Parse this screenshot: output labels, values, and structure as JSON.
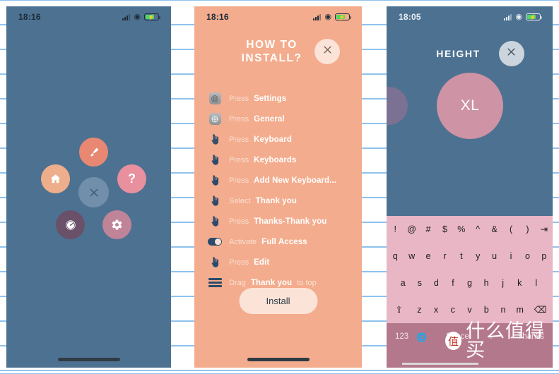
{
  "background": {
    "kind": "ruled-paper",
    "line_color": "#8fc2ee",
    "line_spacing_px": 35
  },
  "panel1": {
    "status": {
      "time": "18:16",
      "signal": "signal-bars-icon",
      "wifi": "wifi-icon",
      "battery": "battery-charging-icon"
    },
    "fab_menu": {
      "center": {
        "label": "",
        "icon": "close-x-icon",
        "color": "#718faa"
      },
      "items": [
        {
          "name": "brush",
          "icon": "paint-brush-icon",
          "color": "#e88872"
        },
        {
          "name": "home",
          "icon": "home-icon",
          "color": "#eeae8b"
        },
        {
          "name": "help",
          "icon": "question-mark-icon",
          "color": "#e9909f",
          "glyph": "?"
        },
        {
          "name": "speed",
          "icon": "speedometer-icon",
          "color": "#6a5069"
        },
        {
          "name": "settings",
          "icon": "gear-icon",
          "color": "#c08498"
        }
      ]
    }
  },
  "panel2": {
    "status": {
      "time": "18:16",
      "signal": "signal-bars-icon",
      "wifi": "wifi-icon",
      "battery": "battery-charging-icon"
    },
    "title_line1": "HOW TO",
    "title_line2": "INSTALL?",
    "close_label": "×",
    "background_color": "#f3ac8d",
    "steps": [
      {
        "icon": "ios-settings-icon",
        "verb": "Press",
        "target": "Settings",
        "suffix": ""
      },
      {
        "icon": "ios-general-icon",
        "verb": "Press",
        "target": "General",
        "suffix": ""
      },
      {
        "icon": "tap-hand-icon",
        "verb": "Press",
        "target": "Keyboard",
        "suffix": ""
      },
      {
        "icon": "tap-hand-icon",
        "verb": "Press",
        "target": "Keyboards",
        "suffix": ""
      },
      {
        "icon": "tap-hand-icon",
        "verb": "Press",
        "target": "Add New Keyboard...",
        "suffix": ""
      },
      {
        "icon": "tap-hand-icon",
        "verb": "Select",
        "target": "Thank you",
        "suffix": ""
      },
      {
        "icon": "tap-hand-icon",
        "verb": "Press",
        "target": "Thanks-Thank you",
        "suffix": ""
      },
      {
        "icon": "toggle-switch-icon",
        "verb": "Activate",
        "target": "Full Access",
        "suffix": ""
      },
      {
        "icon": "tap-hand-icon",
        "verb": "Press",
        "target": "Edit",
        "suffix": ""
      },
      {
        "icon": "drag-handle-icon",
        "verb": "Drag",
        "target": "Thank you",
        "suffix": "to top"
      }
    ],
    "install_button": "Install"
  },
  "panel3": {
    "status": {
      "time": "18:05",
      "signal": "signal-bars-icon",
      "wifi": "wifi-icon",
      "battery": "battery-charging-icon"
    },
    "title": "HEIGHT",
    "close_label": "×",
    "selected_size": "XL",
    "selected_size_color": "#ce93a4",
    "previous_size_color": "#7b7192",
    "background_color": "#4d7191",
    "keyboard": {
      "key_color": "#e8b6c5",
      "bottom_bar_color": "#b4788d",
      "row1": [
        "!",
        "@",
        "#",
        "$",
        "%",
        "^",
        "&",
        "(",
        ")",
        "⇥"
      ],
      "row2": [
        "q",
        "w",
        "e",
        "r",
        "t",
        "y",
        "u",
        "i",
        "o",
        "p"
      ],
      "row3": [
        "a",
        "s",
        "d",
        "f",
        "g",
        "h",
        "j",
        "k",
        "l"
      ],
      "row4": [
        "⇧",
        "z",
        "x",
        "c",
        "v",
        "b",
        "n",
        "m",
        "⌫"
      ],
      "bottom": {
        "numeric": "123",
        "globe": "globe-icon",
        "space": "Space",
        "period": ".",
        "thanks": "Thanks"
      }
    }
  },
  "watermark": {
    "badge": "值",
    "text": "什么值得买"
  }
}
